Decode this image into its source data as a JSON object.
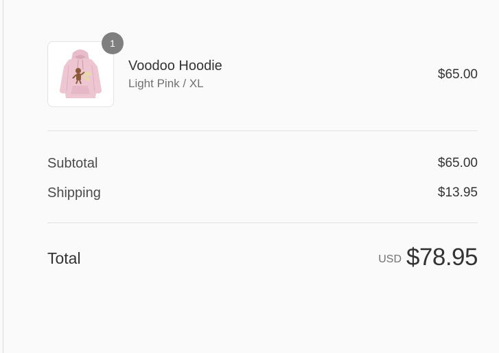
{
  "order_summary": {
    "items": [
      {
        "quantity": "1",
        "name": "Voodoo Hoodie",
        "variant": "Light Pink / XL",
        "price": "$65.00",
        "image_icon": "pink-hoodie-image"
      }
    ],
    "subtotal": {
      "label": "Subtotal",
      "value": "$65.00"
    },
    "shipping": {
      "label": "Shipping",
      "value": "$13.95"
    },
    "total": {
      "label": "Total",
      "currency": "USD",
      "value": "$78.95"
    }
  },
  "colors": {
    "background": "#fafafa",
    "badge": "#7f7f7f",
    "hoodie": "#eec6d2"
  }
}
